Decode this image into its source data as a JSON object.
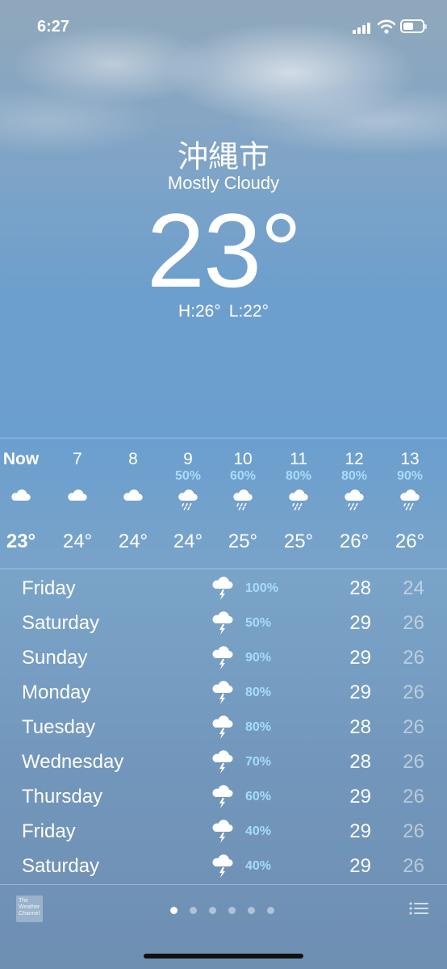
{
  "status": {
    "time": "6:27",
    "icons": [
      "cellular-icon",
      "wifi-icon",
      "battery-icon"
    ]
  },
  "current": {
    "city": "沖縄市",
    "condition": "Mostly Cloudy",
    "temperature": "23°",
    "high": "H:26°",
    "low": "L:22°"
  },
  "hourly": [
    {
      "hour": "Now",
      "precip": "",
      "icon": "cloud-icon",
      "temp": "23°"
    },
    {
      "hour": "7",
      "precip": "",
      "icon": "cloud-icon",
      "temp": "24°"
    },
    {
      "hour": "8",
      "precip": "",
      "icon": "cloud-icon",
      "temp": "24°"
    },
    {
      "hour": "9",
      "precip": "50%",
      "icon": "rain-cloud-icon",
      "temp": "24°"
    },
    {
      "hour": "10",
      "precip": "60%",
      "icon": "rain-cloud-icon",
      "temp": "25°"
    },
    {
      "hour": "11",
      "precip": "80%",
      "icon": "rain-cloud-icon",
      "temp": "25°"
    },
    {
      "hour": "12",
      "precip": "80%",
      "icon": "rain-cloud-icon",
      "temp": "26°"
    },
    {
      "hour": "13",
      "precip": "90%",
      "icon": "rain-cloud-icon",
      "temp": "26°"
    }
  ],
  "daily": [
    {
      "day": "Friday",
      "icon": "thunderstorm-icon",
      "precip": "100%",
      "high": "28",
      "low": "24"
    },
    {
      "day": "Saturday",
      "icon": "thunderstorm-icon",
      "precip": "50%",
      "high": "29",
      "low": "26"
    },
    {
      "day": "Sunday",
      "icon": "thunderstorm-icon",
      "precip": "90%",
      "high": "29",
      "low": "26"
    },
    {
      "day": "Monday",
      "icon": "thunderstorm-icon",
      "precip": "80%",
      "high": "29",
      "low": "26"
    },
    {
      "day": "Tuesday",
      "icon": "thunderstorm-icon",
      "precip": "80%",
      "high": "28",
      "low": "26"
    },
    {
      "day": "Wednesday",
      "icon": "thunderstorm-icon",
      "precip": "70%",
      "high": "28",
      "low": "26"
    },
    {
      "day": "Thursday",
      "icon": "thunderstorm-icon",
      "precip": "60%",
      "high": "29",
      "low": "26"
    },
    {
      "day": "Friday",
      "icon": "thunderstorm-icon",
      "precip": "40%",
      "high": "29",
      "low": "26"
    },
    {
      "day": "Saturday",
      "icon": "thunderstorm-icon",
      "precip": "40%",
      "high": "29",
      "low": "26"
    }
  ],
  "footer": {
    "logo_text": "The Weather Channel",
    "page_count": 6,
    "active_page": 0
  },
  "colors": {
    "precip": "#a6dcf8",
    "low_temp": "rgba(255,255,255,0.5)"
  }
}
